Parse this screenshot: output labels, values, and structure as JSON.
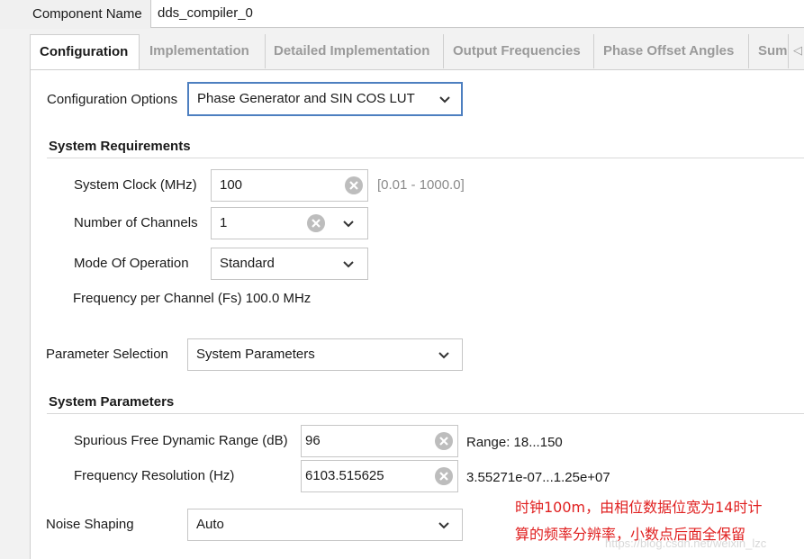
{
  "component": {
    "label": "Component Name",
    "value": "dds_compiler_0"
  },
  "tabs": [
    {
      "label": "Configuration",
      "active": true
    },
    {
      "label": "Implementation",
      "active": false
    },
    {
      "label": "Detailed Implementation",
      "active": false
    },
    {
      "label": "Output Frequencies",
      "active": false
    },
    {
      "label": "Phase Offset Angles",
      "active": false
    },
    {
      "label": "Sum",
      "active": false
    }
  ],
  "config_options": {
    "label": "Configuration Options",
    "value": "Phase Generator and SIN COS LUT"
  },
  "system_requirements": {
    "title": "System Requirements",
    "clock": {
      "label": "System Clock (MHz)",
      "value": "100",
      "range": "[0.01 - 1000.0]"
    },
    "channels": {
      "label": "Number of Channels",
      "value": "1"
    },
    "mode": {
      "label": "Mode Of Operation",
      "value": "Standard"
    },
    "fs_text": "Frequency per Channel (Fs) 100.0 MHz"
  },
  "parameter_selection": {
    "label": "Parameter Selection",
    "value": "System Parameters"
  },
  "system_parameters": {
    "title": "System Parameters",
    "sfdr": {
      "label": "Spurious Free Dynamic Range (dB)",
      "value": "96",
      "range": "Range: 18...150"
    },
    "freq_res": {
      "label": "Frequency Resolution (Hz)",
      "value": "6103.515625",
      "range": "3.55271e-07...1.25e+07"
    }
  },
  "noise_shaping": {
    "label": "Noise Shaping",
    "value": "Auto"
  },
  "annotation": {
    "line1": "时钟100m，由相位数据位宽为14时计",
    "line2": "算的频率分辨率，小数点后面全保留"
  },
  "watermark": "https://blog.csdn.net/weixin_lzc",
  "colors": {
    "focus_border": "#4d7fc0",
    "annotation": "#e02020"
  },
  "icons": {
    "dropdown": "chevron-down-icon",
    "clear": "clear-x-circle-icon",
    "tab_scroll": "triangle-left-icon"
  }
}
